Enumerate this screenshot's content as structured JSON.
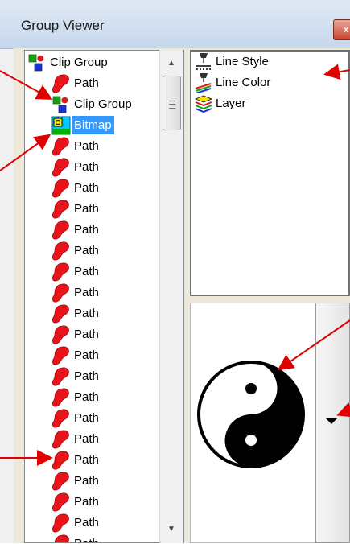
{
  "window": {
    "title": "Group Viewer",
    "close_glyph": "x"
  },
  "tree": {
    "items": [
      {
        "label": "Clip Group",
        "icon": "clip-group-icon",
        "indent": 0,
        "selected": false
      },
      {
        "label": "Path",
        "icon": "path-icon",
        "indent": 1,
        "selected": false
      },
      {
        "label": "Clip Group",
        "icon": "clip-group-icon",
        "indent": 1,
        "selected": false
      },
      {
        "label": "Bitmap",
        "icon": "bitmap-icon",
        "indent": 1,
        "selected": true
      },
      {
        "label": "Path",
        "icon": "path-icon",
        "indent": 1,
        "selected": false
      },
      {
        "label": "Path",
        "icon": "path-icon",
        "indent": 1,
        "selected": false
      },
      {
        "label": "Path",
        "icon": "path-icon",
        "indent": 1,
        "selected": false
      },
      {
        "label": "Path",
        "icon": "path-icon",
        "indent": 1,
        "selected": false
      },
      {
        "label": "Path",
        "icon": "path-icon",
        "indent": 1,
        "selected": false
      },
      {
        "label": "Path",
        "icon": "path-icon",
        "indent": 1,
        "selected": false
      },
      {
        "label": "Path",
        "icon": "path-icon",
        "indent": 1,
        "selected": false
      },
      {
        "label": "Path",
        "icon": "path-icon",
        "indent": 1,
        "selected": false
      },
      {
        "label": "Path",
        "icon": "path-icon",
        "indent": 1,
        "selected": false
      },
      {
        "label": "Path",
        "icon": "path-icon",
        "indent": 1,
        "selected": false
      },
      {
        "label": "Path",
        "icon": "path-icon",
        "indent": 1,
        "selected": false
      },
      {
        "label": "Path",
        "icon": "path-icon",
        "indent": 1,
        "selected": false
      },
      {
        "label": "Path",
        "icon": "path-icon",
        "indent": 1,
        "selected": false
      },
      {
        "label": "Path",
        "icon": "path-icon",
        "indent": 1,
        "selected": false
      },
      {
        "label": "Path",
        "icon": "path-icon",
        "indent": 1,
        "selected": false
      },
      {
        "label": "Path",
        "icon": "path-icon",
        "indent": 1,
        "selected": false
      },
      {
        "label": "Path",
        "icon": "path-icon",
        "indent": 1,
        "selected": false
      },
      {
        "label": "Path",
        "icon": "path-icon",
        "indent": 1,
        "selected": false
      },
      {
        "label": "Path",
        "icon": "path-icon",
        "indent": 1,
        "selected": false
      },
      {
        "label": "Path",
        "icon": "path-icon",
        "indent": 1,
        "selected": false
      }
    ]
  },
  "attributes": {
    "items": [
      {
        "label": "Line Style",
        "icon": "line-style-icon"
      },
      {
        "label": "Line Color",
        "icon": "line-color-icon"
      },
      {
        "label": "Layer",
        "icon": "layer-icon"
      }
    ]
  },
  "preview": {
    "icon": "yin-yang-icon"
  },
  "colors": {
    "selection": "#3399ff",
    "path_red": "#e8141c",
    "annotation_arrow": "#e00000"
  }
}
